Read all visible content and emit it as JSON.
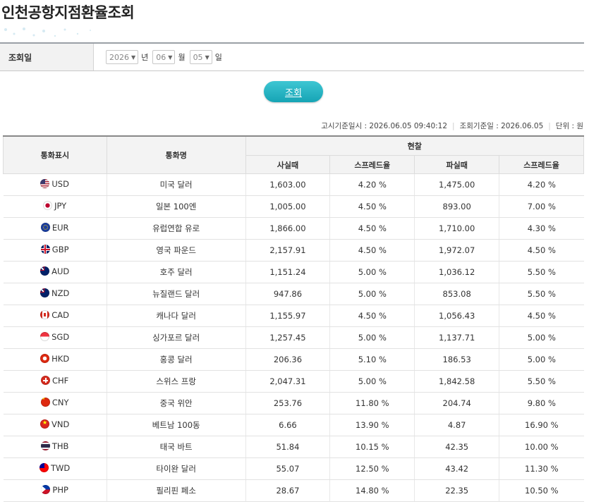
{
  "header": {
    "title": "인천공항지점환율조회"
  },
  "search": {
    "label": "조회일",
    "year": "2026",
    "year_unit": "년",
    "month": "06",
    "month_unit": "월",
    "day": "05",
    "day_unit": "일",
    "button_label": "조회"
  },
  "info": {
    "notice_label": "고시기준일시 :",
    "notice_value": "2026.06.05 09:40:12",
    "query_label": "조회기준일 :",
    "query_value": "2026.06.05",
    "unit_label": "단위 : 원"
  },
  "table": {
    "headers": {
      "currency_code": "통화표시",
      "currency_name": "통화명",
      "cash": "현찰",
      "buy": "사실때",
      "buy_spread": "스프레드율",
      "sell": "파실때",
      "sell_spread": "스프레드율"
    },
    "rows": [
      {
        "code": "USD",
        "name": "미국 달러",
        "buy": "1,603.00",
        "buy_spread": "4.20 %",
        "sell": "1,475.00",
        "sell_spread": "4.20 %",
        "flag": "us-flag-icon"
      },
      {
        "code": "JPY",
        "name": "일본 100엔",
        "buy": "1,005.00",
        "buy_spread": "4.50 %",
        "sell": "893.00",
        "sell_spread": "7.00 %",
        "flag": "jp-flag-icon"
      },
      {
        "code": "EUR",
        "name": "유럽연합 유로",
        "buy": "1,866.00",
        "buy_spread": "4.50 %",
        "sell": "1,710.00",
        "sell_spread": "4.30 %",
        "flag": "eu-flag-icon"
      },
      {
        "code": "GBP",
        "name": "영국 파운드",
        "buy": "2,157.91",
        "buy_spread": "4.50 %",
        "sell": "1,972.07",
        "sell_spread": "4.50 %",
        "flag": "gb-flag-icon"
      },
      {
        "code": "AUD",
        "name": "호주 달러",
        "buy": "1,151.24",
        "buy_spread": "5.00 %",
        "sell": "1,036.12",
        "sell_spread": "5.50 %",
        "flag": "au-flag-icon"
      },
      {
        "code": "NZD",
        "name": "뉴질랜드 달러",
        "buy": "947.86",
        "buy_spread": "5.00 %",
        "sell": "853.08",
        "sell_spread": "5.50 %",
        "flag": "nz-flag-icon"
      },
      {
        "code": "CAD",
        "name": "캐나다 달러",
        "buy": "1,155.97",
        "buy_spread": "4.50 %",
        "sell": "1,056.43",
        "sell_spread": "4.50 %",
        "flag": "ca-flag-icon"
      },
      {
        "code": "SGD",
        "name": "싱가포르 달러",
        "buy": "1,257.45",
        "buy_spread": "5.00 %",
        "sell": "1,137.71",
        "sell_spread": "5.00 %",
        "flag": "sg-flag-icon"
      },
      {
        "code": "HKD",
        "name": "홍콩 달러",
        "buy": "206.36",
        "buy_spread": "5.10 %",
        "sell": "186.53",
        "sell_spread": "5.00 %",
        "flag": "hk-flag-icon"
      },
      {
        "code": "CHF",
        "name": "스위스 프랑",
        "buy": "2,047.31",
        "buy_spread": "5.00 %",
        "sell": "1,842.58",
        "sell_spread": "5.50 %",
        "flag": "ch-flag-icon"
      },
      {
        "code": "CNY",
        "name": "중국 위안",
        "buy": "253.76",
        "buy_spread": "11.80 %",
        "sell": "204.74",
        "sell_spread": "9.80 %",
        "flag": "cn-flag-icon"
      },
      {
        "code": "VND",
        "name": "베트남 100동",
        "buy": "6.66",
        "buy_spread": "13.90 %",
        "sell": "4.87",
        "sell_spread": "16.90 %",
        "flag": "vn-flag-icon"
      },
      {
        "code": "THB",
        "name": "태국 바트",
        "buy": "51.84",
        "buy_spread": "10.15 %",
        "sell": "42.35",
        "sell_spread": "10.00 %",
        "flag": "th-flag-icon"
      },
      {
        "code": "TWD",
        "name": "타이완 달러",
        "buy": "55.07",
        "buy_spread": "12.50 %",
        "sell": "43.42",
        "sell_spread": "11.30 %",
        "flag": "tw-flag-icon"
      },
      {
        "code": "PHP",
        "name": "필리핀 페소",
        "buy": "28.67",
        "buy_spread": "14.80 %",
        "sell": "22.35",
        "sell_spread": "10.50 %",
        "flag": "ph-flag-icon"
      }
    ]
  }
}
